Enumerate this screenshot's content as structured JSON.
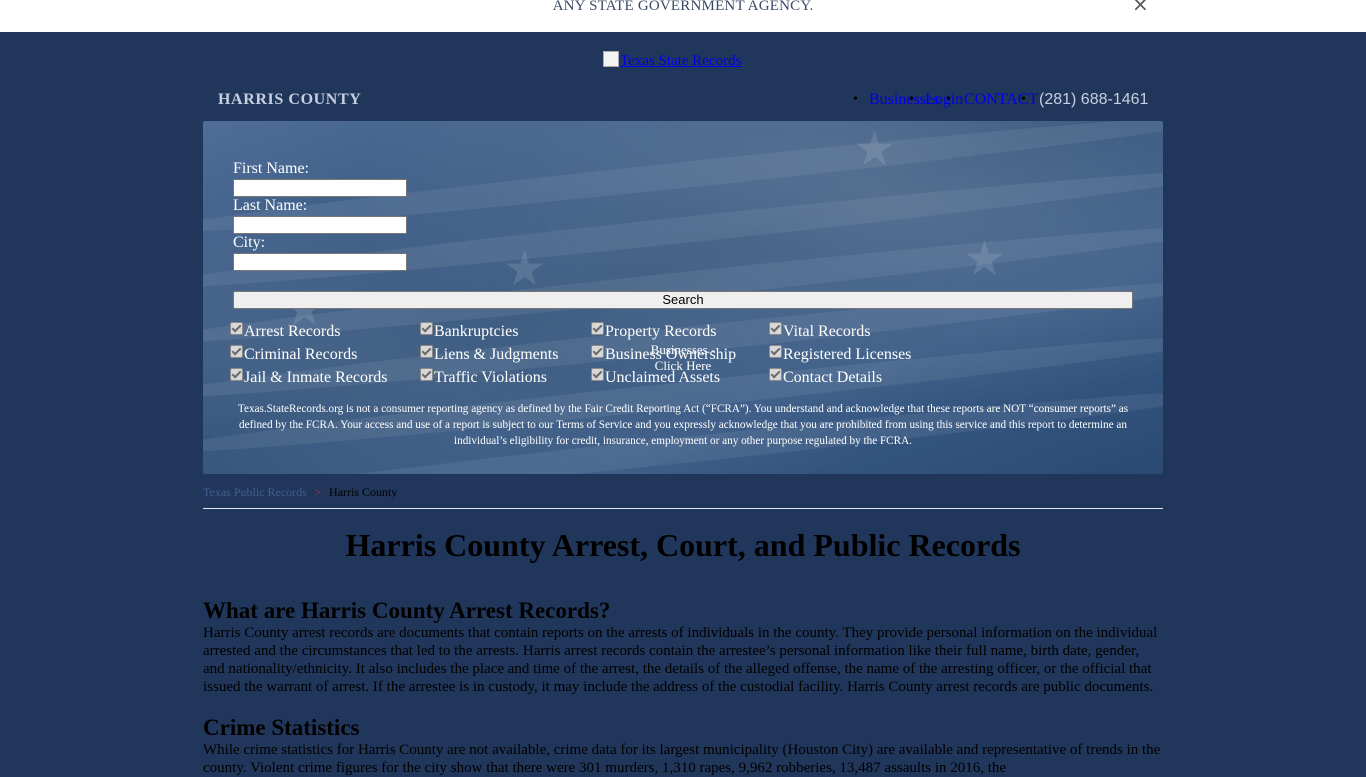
{
  "banner": {
    "text": "ANY STATE GOVERNMENT AGENCY.",
    "close_label": "×"
  },
  "header": {
    "logo_alt": "Texas State Records",
    "county": "HARRIS COUNTY",
    "nav": {
      "businesses": "Businesses",
      "login": "Login",
      "contact": "CONTACT",
      "phone": "(281) 688-1461"
    }
  },
  "search_form": {
    "first_name_label": "First Name:",
    "last_name_label": "Last Name:",
    "city_label": "City:",
    "first_name_value": "",
    "last_name_value": "",
    "city_value": "",
    "search_button": "Search",
    "checkboxes": [
      [
        "Arrest Records",
        "Bankruptcies",
        "Property Records",
        "Vital Records"
      ],
      [
        "Criminal Records",
        "Liens & Judgments",
        "Business Ownership",
        "Registered Licenses"
      ],
      [
        "Jail & Inmate Records",
        "Traffic Violations",
        "Unclaimed Assets",
        "Contact Details"
      ]
    ],
    "business_overlay_line1": "Businesses -",
    "business_overlay_line2": "Click Here",
    "disclaimer": "Texas.StateRecords.org is not a consumer reporting agency as defined by the Fair Credit Reporting Act (“FCRA”). You understand and acknowledge that these reports are NOT “consumer reports” as defined by the FCRA. Your access and use of a report is subject to our Terms of Service and you expressly acknowledge that you are prohibited from using this service and this report to determine an individual’s eligibility for credit, insurance, employment or any other purpose regulated by the FCRA."
  },
  "breadcrumb": {
    "parent": "Texas Public Records",
    "separator": ">",
    "current": "Harris County"
  },
  "main": {
    "title": "Harris County Arrest, Court, and Public Records",
    "sections": [
      {
        "heading": "What are Harris County Arrest Records?",
        "body": "Harris County arrest records are documents that contain reports on the arrests of individuals in the county. They provide personal information on the individual arrested and the circumstances that led to the arrests. Harris arrest records contain the arrestee’s personal information like their full name, birth date, gender, and nationality/ethnicity. It also includes the place and time of the arrest, the details of the alleged offense, the name of the arresting officer, or the official that issued the warrant of arrest. If the arrestee is in custody, it may include the address of the custodial facility. Harris County arrest records are public documents."
      },
      {
        "heading": "Crime Statistics",
        "body": "While crime statistics for Harris County are not available, crime data for its largest municipality (Houston City) are available and representative of trends in the county. Violent crime figures for the city show that there were 301 murders, 1,310 rapes, 9,962 robberies, 13,487 assaults in 2016, the"
      }
    ]
  }
}
